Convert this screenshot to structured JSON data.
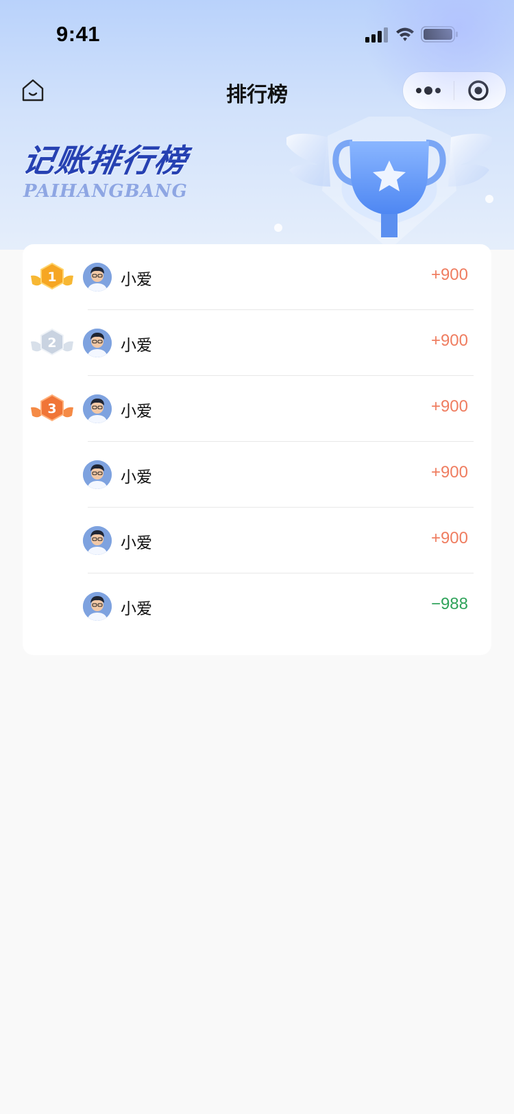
{
  "status_bar": {
    "time": "9:41"
  },
  "nav": {
    "title": "排行榜"
  },
  "banner": {
    "title": "记账排行榜",
    "subtitle": "PAIHANGBANG"
  },
  "ranking": [
    {
      "rank": "1",
      "name": "小爱",
      "score": "+900",
      "trend": "positive"
    },
    {
      "rank": "2",
      "name": "小爱",
      "score": "+900",
      "trend": "positive"
    },
    {
      "rank": "3",
      "name": "小爱",
      "score": "+900",
      "trend": "positive"
    },
    {
      "rank": "",
      "name": "小爱",
      "score": "+900",
      "trend": "positive"
    },
    {
      "rank": "",
      "name": "小爱",
      "score": "+900",
      "trend": "positive"
    },
    {
      "rank": "",
      "name": "小爱",
      "score": "−988",
      "trend": "negative"
    }
  ],
  "colors": {
    "positive": "#ef7d60",
    "negative": "#2fa35a",
    "banner_title": "#2641b2",
    "gold": "#f6a623",
    "silver": "#c9d3e1",
    "bronze": "#f07537"
  },
  "icons": {
    "home": "home-icon",
    "more": "more-dots-icon",
    "close": "target-close-icon",
    "medals": [
      "gold-medal-icon",
      "silver-medal-icon",
      "bronze-medal-icon"
    ]
  }
}
